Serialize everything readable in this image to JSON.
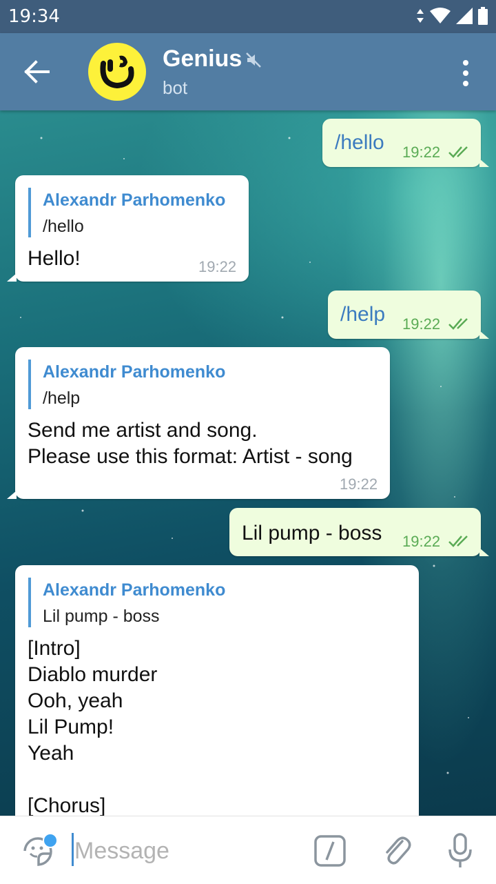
{
  "status_bar": {
    "time": "19:34"
  },
  "header": {
    "title": "Genius",
    "subtitle": "bot"
  },
  "messages": [
    {
      "dir": "out",
      "text": "/hello",
      "time": "19:22"
    },
    {
      "dir": "in",
      "reply_name": "Alexandr Parhomenko",
      "reply_text": "/hello",
      "text": "Hello!",
      "time": "19:22"
    },
    {
      "dir": "out",
      "text": "/help",
      "time": "19:22"
    },
    {
      "dir": "in",
      "reply_name": "Alexandr Parhomenko",
      "reply_text": "/help",
      "text": "Send me artist and song.\nPlease use this format: Artist - song",
      "time": "19:22"
    },
    {
      "dir": "out",
      "text": "Lil pump - boss",
      "time": "19:22"
    },
    {
      "dir": "in",
      "reply_name": "Alexandr Parhomenko",
      "reply_text": "Lil pump - boss",
      "text": "[Intro]\nDiablo murder\nOoh, yeah\nLil Pump!\nYeah\n\n[Chorus]"
    }
  ],
  "input": {
    "placeholder": "Message"
  },
  "icons": {
    "back": "arrow-left-icon",
    "mute": "muted-speaker-icon",
    "menu": "more-vert-icon",
    "emoji": "sticker-icon",
    "command": "slash-command-icon",
    "attach": "paperclip-icon",
    "mic": "microphone-icon",
    "read": "double-check-icon"
  },
  "colors": {
    "status_bar": "#3f5d7c",
    "header": "#527da3",
    "outgoing_bubble": "#effdde",
    "incoming_bubble": "#ffffff",
    "link_blue": "#3f8bd0",
    "check_green": "#5aab55",
    "avatar_yellow": "#fdf13a"
  }
}
